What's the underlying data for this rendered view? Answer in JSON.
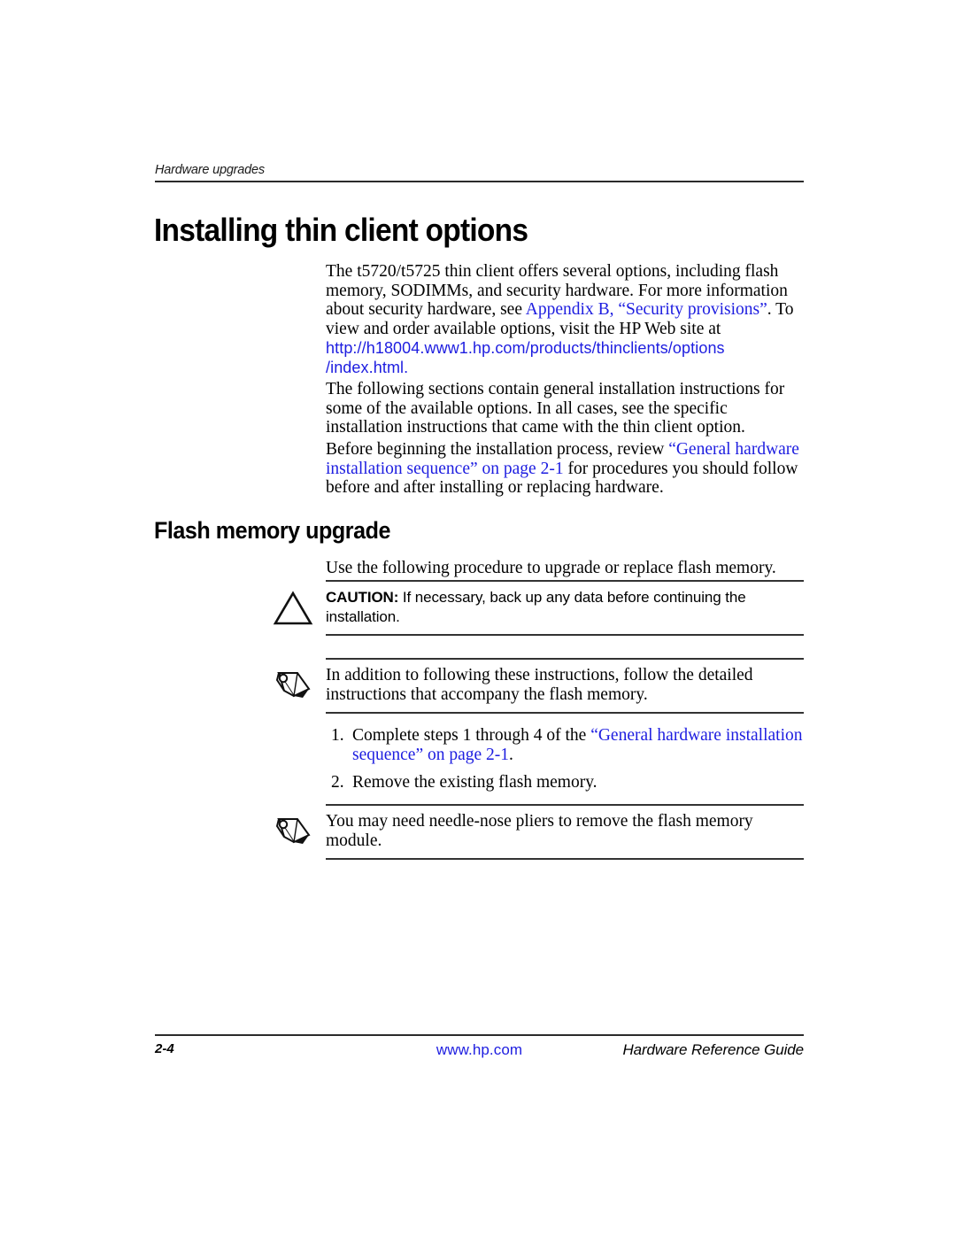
{
  "header": {
    "running_title": "Hardware upgrades"
  },
  "headings": {
    "h1": "Installing thin client options",
    "h2": "Flash memory upgrade"
  },
  "paragraphs": {
    "intro": {
      "part1": "The t5720/t5725 thin client offers several options, including flash memory, SODIMMs, and security hardware. For more information about security hardware, see ",
      "link_appendix": "Appendix B, “Security provisions”",
      "part2": ". To view and order available options, visit the HP Web site at ",
      "link_url_line1": "http://h18004.www1.hp.com/products/thinclients/options",
      "link_url_line2": "/index.html",
      "part3": "."
    },
    "sections": "The following sections contain general installation instructions for some of the available options. In all cases, see the specific installation instructions that came with the thin client option.",
    "before": {
      "part1": "Before beginning the installation process, review ",
      "link": "“General hardware installation sequence” on page 2-1",
      "part2": " for procedures you should follow before and after installing or replacing hardware."
    },
    "flash_intro": "Use the following procedure to upgrade or replace flash memory."
  },
  "callouts": {
    "caution": {
      "icon": "caution-triangle-icon",
      "label": "CAUTION:",
      "text": " If necessary, back up any data before continuing the installation."
    },
    "note1": {
      "icon": "note-pencil-icon",
      "text": "In addition to following these instructions, follow the detailed instructions that accompany the flash memory."
    },
    "note2": {
      "icon": "note-pencil-icon",
      "text": "You may need needle-nose pliers to remove the flash memory module."
    }
  },
  "steps": [
    {
      "num": "1.",
      "part1": "Complete steps 1 through 4 of the ",
      "link": "“General hardware installation sequence” on page 2-1",
      "part2": "."
    },
    {
      "num": "2.",
      "part1": "Remove the existing flash memory.",
      "link": "",
      "part2": ""
    }
  ],
  "footer": {
    "page_number": "2-4",
    "url": "www.hp.com",
    "guide_title": "Hardware Reference Guide"
  },
  "colors": {
    "link_blue": "#1d1de0",
    "rule_gray": "#333333",
    "text_black": "#000000"
  }
}
